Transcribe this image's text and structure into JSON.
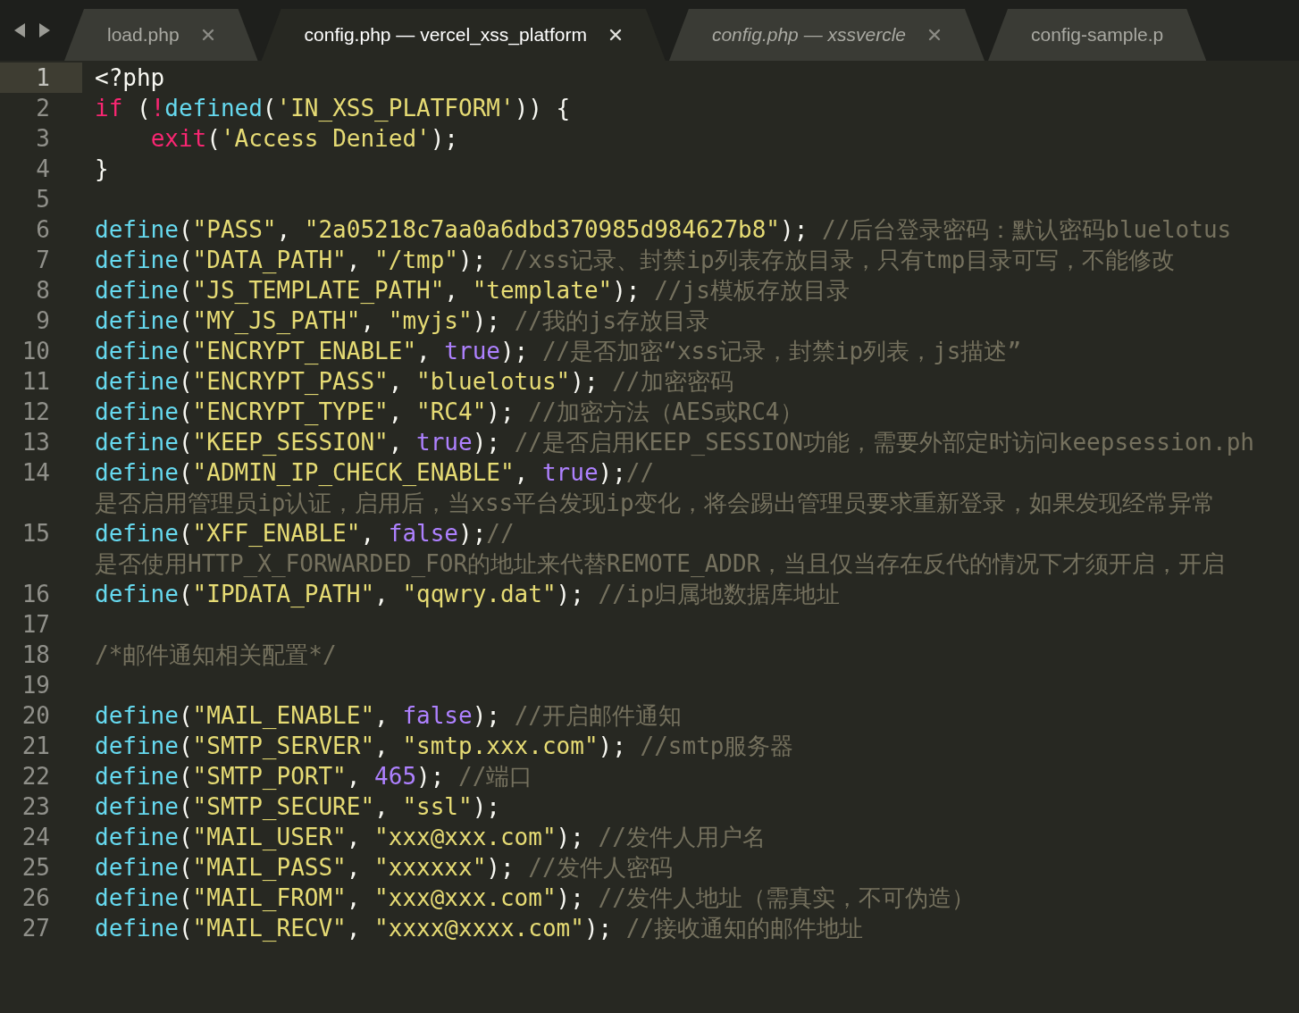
{
  "tabs": [
    {
      "label": "load.php",
      "selected": false,
      "preview": false,
      "closable": true
    },
    {
      "label": "config.php — vercel_xss_platform",
      "selected": true,
      "preview": false,
      "closable": true
    },
    {
      "label": "config.php — xssvercle",
      "selected": false,
      "preview": true,
      "closable": true
    },
    {
      "label": "config-sample.p",
      "selected": false,
      "preview": false,
      "closable": false
    }
  ],
  "editor": {
    "lines": [
      {
        "number": "1",
        "current": true,
        "rows": [
          [
            {
              "kind": "plain",
              "text": "<?php"
            }
          ]
        ]
      },
      {
        "number": "2",
        "current": false,
        "rows": [
          [
            {
              "kind": "keyword",
              "text": "if"
            },
            {
              "kind": "plain",
              "text": " ("
            },
            {
              "kind": "keyword",
              "text": "!"
            },
            {
              "kind": "function",
              "text": "defined"
            },
            {
              "kind": "plain",
              "text": "("
            },
            {
              "kind": "string",
              "text": "'IN_XSS_PLATFORM'"
            },
            {
              "kind": "plain",
              "text": ")) {"
            }
          ]
        ]
      },
      {
        "number": "3",
        "current": false,
        "rows": [
          [
            {
              "kind": "plain",
              "text": "    "
            },
            {
              "kind": "keyword",
              "text": "exit"
            },
            {
              "kind": "plain",
              "text": "("
            },
            {
              "kind": "string",
              "text": "'Access Denied'"
            },
            {
              "kind": "plain",
              "text": ");"
            }
          ]
        ]
      },
      {
        "number": "4",
        "current": false,
        "rows": [
          [
            {
              "kind": "plain",
              "text": "}"
            }
          ]
        ]
      },
      {
        "number": "5",
        "current": false
      },
      {
        "number": "6",
        "current": false,
        "rows": [
          [
            {
              "kind": "function",
              "text": "define"
            },
            {
              "kind": "plain",
              "text": "("
            },
            {
              "kind": "string",
              "text": "\"PASS\""
            },
            {
              "kind": "plain",
              "text": ", "
            },
            {
              "kind": "string",
              "text": "\"2a05218c7aa0a6dbd370985d984627b8\""
            },
            {
              "kind": "plain",
              "text": "); "
            },
            {
              "kind": "comment",
              "text": "//后台登录密码：默认密码bluelotus"
            }
          ]
        ]
      },
      {
        "number": "7",
        "current": false,
        "rows": [
          [
            {
              "kind": "function",
              "text": "define"
            },
            {
              "kind": "plain",
              "text": "("
            },
            {
              "kind": "string",
              "text": "\"DATA_PATH\""
            },
            {
              "kind": "plain",
              "text": ", "
            },
            {
              "kind": "string",
              "text": "\"/tmp\""
            },
            {
              "kind": "plain",
              "text": "); "
            },
            {
              "kind": "comment",
              "text": "//xss记录、封禁ip列表存放目录，只有tmp目录可写，不能修改"
            }
          ]
        ]
      },
      {
        "number": "8",
        "current": false,
        "rows": [
          [
            {
              "kind": "function",
              "text": "define"
            },
            {
              "kind": "plain",
              "text": "("
            },
            {
              "kind": "string",
              "text": "\"JS_TEMPLATE_PATH\""
            },
            {
              "kind": "plain",
              "text": ", "
            },
            {
              "kind": "string",
              "text": "\"template\""
            },
            {
              "kind": "plain",
              "text": "); "
            },
            {
              "kind": "comment",
              "text": "//js模板存放目录"
            }
          ]
        ]
      },
      {
        "number": "9",
        "current": false,
        "rows": [
          [
            {
              "kind": "function",
              "text": "define"
            },
            {
              "kind": "plain",
              "text": "("
            },
            {
              "kind": "string",
              "text": "\"MY_JS_PATH\""
            },
            {
              "kind": "plain",
              "text": ", "
            },
            {
              "kind": "string",
              "text": "\"myjs\""
            },
            {
              "kind": "plain",
              "text": "); "
            },
            {
              "kind": "comment",
              "text": "//我的js存放目录"
            }
          ]
        ]
      },
      {
        "number": "10",
        "current": false,
        "rows": [
          [
            {
              "kind": "function",
              "text": "define"
            },
            {
              "kind": "plain",
              "text": "("
            },
            {
              "kind": "string",
              "text": "\"ENCRYPT_ENABLE\""
            },
            {
              "kind": "plain",
              "text": ", "
            },
            {
              "kind": "constant",
              "text": "true"
            },
            {
              "kind": "plain",
              "text": "); "
            },
            {
              "kind": "comment",
              "text": "//是否加密“xss记录，封禁ip列表，js描述”"
            }
          ]
        ]
      },
      {
        "number": "11",
        "current": false,
        "rows": [
          [
            {
              "kind": "function",
              "text": "define"
            },
            {
              "kind": "plain",
              "text": "("
            },
            {
              "kind": "string",
              "text": "\"ENCRYPT_PASS\""
            },
            {
              "kind": "plain",
              "text": ", "
            },
            {
              "kind": "string",
              "text": "\"bluelotus\""
            },
            {
              "kind": "plain",
              "text": "); "
            },
            {
              "kind": "comment",
              "text": "//加密密码"
            }
          ]
        ]
      },
      {
        "number": "12",
        "current": false,
        "rows": [
          [
            {
              "kind": "function",
              "text": "define"
            },
            {
              "kind": "plain",
              "text": "("
            },
            {
              "kind": "string",
              "text": "\"ENCRYPT_TYPE\""
            },
            {
              "kind": "plain",
              "text": ", "
            },
            {
              "kind": "string",
              "text": "\"RC4\""
            },
            {
              "kind": "plain",
              "text": "); "
            },
            {
              "kind": "comment",
              "text": "//加密方法（AES或RC4）"
            }
          ]
        ]
      },
      {
        "number": "13",
        "current": false,
        "rows": [
          [
            {
              "kind": "function",
              "text": "define"
            },
            {
              "kind": "plain",
              "text": "("
            },
            {
              "kind": "string",
              "text": "\"KEEP_SESSION\""
            },
            {
              "kind": "plain",
              "text": ", "
            },
            {
              "kind": "constant",
              "text": "true"
            },
            {
              "kind": "plain",
              "text": "); "
            },
            {
              "kind": "comment",
              "text": "//是否启用KEEP_SESSION功能，需要外部定时访问keepsession.ph"
            }
          ]
        ]
      },
      {
        "number": "14",
        "current": false,
        "rows": [
          [
            {
              "kind": "function",
              "text": "define"
            },
            {
              "kind": "plain",
              "text": "("
            },
            {
              "kind": "string",
              "text": "\"ADMIN_IP_CHECK_ENABLE\""
            },
            {
              "kind": "plain",
              "text": ", "
            },
            {
              "kind": "constant",
              "text": "true"
            },
            {
              "kind": "plain",
              "text": ");"
            },
            {
              "kind": "comment",
              "text": "//"
            }
          ],
          [
            {
              "kind": "comment",
              "text": "是否启用管理员ip认证，启用后，当xss平台发现ip变化，将会踢出管理员要求重新登录，如果发现经常异常"
            }
          ]
        ]
      },
      {
        "number": "15",
        "current": false,
        "rows": [
          [
            {
              "kind": "function",
              "text": "define"
            },
            {
              "kind": "plain",
              "text": "("
            },
            {
              "kind": "string",
              "text": "\"XFF_ENABLE\""
            },
            {
              "kind": "plain",
              "text": ", "
            },
            {
              "kind": "constant",
              "text": "false"
            },
            {
              "kind": "plain",
              "text": ");"
            },
            {
              "kind": "comment",
              "text": "//"
            }
          ],
          [
            {
              "kind": "comment",
              "text": "是否使用HTTP_X_FORWARDED_FOR的地址来代替REMOTE_ADDR，当且仅当存在反代的情况下才须开启，开启"
            }
          ]
        ]
      },
      {
        "number": "16",
        "current": false,
        "rows": [
          [
            {
              "kind": "function",
              "text": "define"
            },
            {
              "kind": "plain",
              "text": "("
            },
            {
              "kind": "string",
              "text": "\"IPDATA_PATH\""
            },
            {
              "kind": "plain",
              "text": ", "
            },
            {
              "kind": "string",
              "text": "\"qqwry.dat\""
            },
            {
              "kind": "plain",
              "text": "); "
            },
            {
              "kind": "comment",
              "text": "//ip归属地数据库地址"
            }
          ]
        ]
      },
      {
        "number": "17",
        "current": false
      },
      {
        "number": "18",
        "current": false,
        "rows": [
          [
            {
              "kind": "comment",
              "text": "/*邮件通知相关配置*/"
            }
          ]
        ]
      },
      {
        "number": "19",
        "current": false
      },
      {
        "number": "20",
        "current": false,
        "rows": [
          [
            {
              "kind": "function",
              "text": "define"
            },
            {
              "kind": "plain",
              "text": "("
            },
            {
              "kind": "string",
              "text": "\"MAIL_ENABLE\""
            },
            {
              "kind": "plain",
              "text": ", "
            },
            {
              "kind": "constant",
              "text": "false"
            },
            {
              "kind": "plain",
              "text": "); "
            },
            {
              "kind": "comment",
              "text": "//开启邮件通知"
            }
          ]
        ]
      },
      {
        "number": "21",
        "current": false,
        "rows": [
          [
            {
              "kind": "function",
              "text": "define"
            },
            {
              "kind": "plain",
              "text": "("
            },
            {
              "kind": "string",
              "text": "\"SMTP_SERVER\""
            },
            {
              "kind": "plain",
              "text": ", "
            },
            {
              "kind": "string",
              "text": "\"smtp.xxx.com\""
            },
            {
              "kind": "plain",
              "text": "); "
            },
            {
              "kind": "comment",
              "text": "//smtp服务器"
            }
          ]
        ]
      },
      {
        "number": "22",
        "current": false,
        "rows": [
          [
            {
              "kind": "function",
              "text": "define"
            },
            {
              "kind": "plain",
              "text": "("
            },
            {
              "kind": "string",
              "text": "\"SMTP_PORT\""
            },
            {
              "kind": "plain",
              "text": ", "
            },
            {
              "kind": "constant",
              "text": "465"
            },
            {
              "kind": "plain",
              "text": "); "
            },
            {
              "kind": "comment",
              "text": "//端口"
            }
          ]
        ]
      },
      {
        "number": "23",
        "current": false,
        "rows": [
          [
            {
              "kind": "function",
              "text": "define"
            },
            {
              "kind": "plain",
              "text": "("
            },
            {
              "kind": "string",
              "text": "\"SMTP_SECURE\""
            },
            {
              "kind": "plain",
              "text": ", "
            },
            {
              "kind": "string",
              "text": "\"ssl\""
            },
            {
              "kind": "plain",
              "text": ");"
            }
          ]
        ]
      },
      {
        "number": "24",
        "current": false,
        "rows": [
          [
            {
              "kind": "function",
              "text": "define"
            },
            {
              "kind": "plain",
              "text": "("
            },
            {
              "kind": "string",
              "text": "\"MAIL_USER\""
            },
            {
              "kind": "plain",
              "text": ", "
            },
            {
              "kind": "string",
              "text": "\"xxx@xxx.com\""
            },
            {
              "kind": "plain",
              "text": "); "
            },
            {
              "kind": "comment",
              "text": "//发件人用户名"
            }
          ]
        ]
      },
      {
        "number": "25",
        "current": false,
        "rows": [
          [
            {
              "kind": "function",
              "text": "define"
            },
            {
              "kind": "plain",
              "text": "("
            },
            {
              "kind": "string",
              "text": "\"MAIL_PASS\""
            },
            {
              "kind": "plain",
              "text": ", "
            },
            {
              "kind": "string",
              "text": "\"xxxxxx\""
            },
            {
              "kind": "plain",
              "text": "); "
            },
            {
              "kind": "comment",
              "text": "//发件人密码"
            }
          ]
        ]
      },
      {
        "number": "26",
        "current": false,
        "rows": [
          [
            {
              "kind": "function",
              "text": "define"
            },
            {
              "kind": "plain",
              "text": "("
            },
            {
              "kind": "string",
              "text": "\"MAIL_FROM\""
            },
            {
              "kind": "plain",
              "text": ", "
            },
            {
              "kind": "string",
              "text": "\"xxx@xxx.com\""
            },
            {
              "kind": "plain",
              "text": "); "
            },
            {
              "kind": "comment",
              "text": "//发件人地址（需真实，不可伪造）"
            }
          ]
        ]
      },
      {
        "number": "27",
        "current": false,
        "rows": [
          [
            {
              "kind": "function",
              "text": "define"
            },
            {
              "kind": "plain",
              "text": "("
            },
            {
              "kind": "string",
              "text": "\"MAIL_RECV\""
            },
            {
              "kind": "plain",
              "text": ", "
            },
            {
              "kind": "string",
              "text": "\"xxxx@xxxx.com\""
            },
            {
              "kind": "plain",
              "text": "); "
            },
            {
              "kind": "comment",
              "text": "//接收通知的邮件地址"
            }
          ]
        ]
      }
    ]
  }
}
